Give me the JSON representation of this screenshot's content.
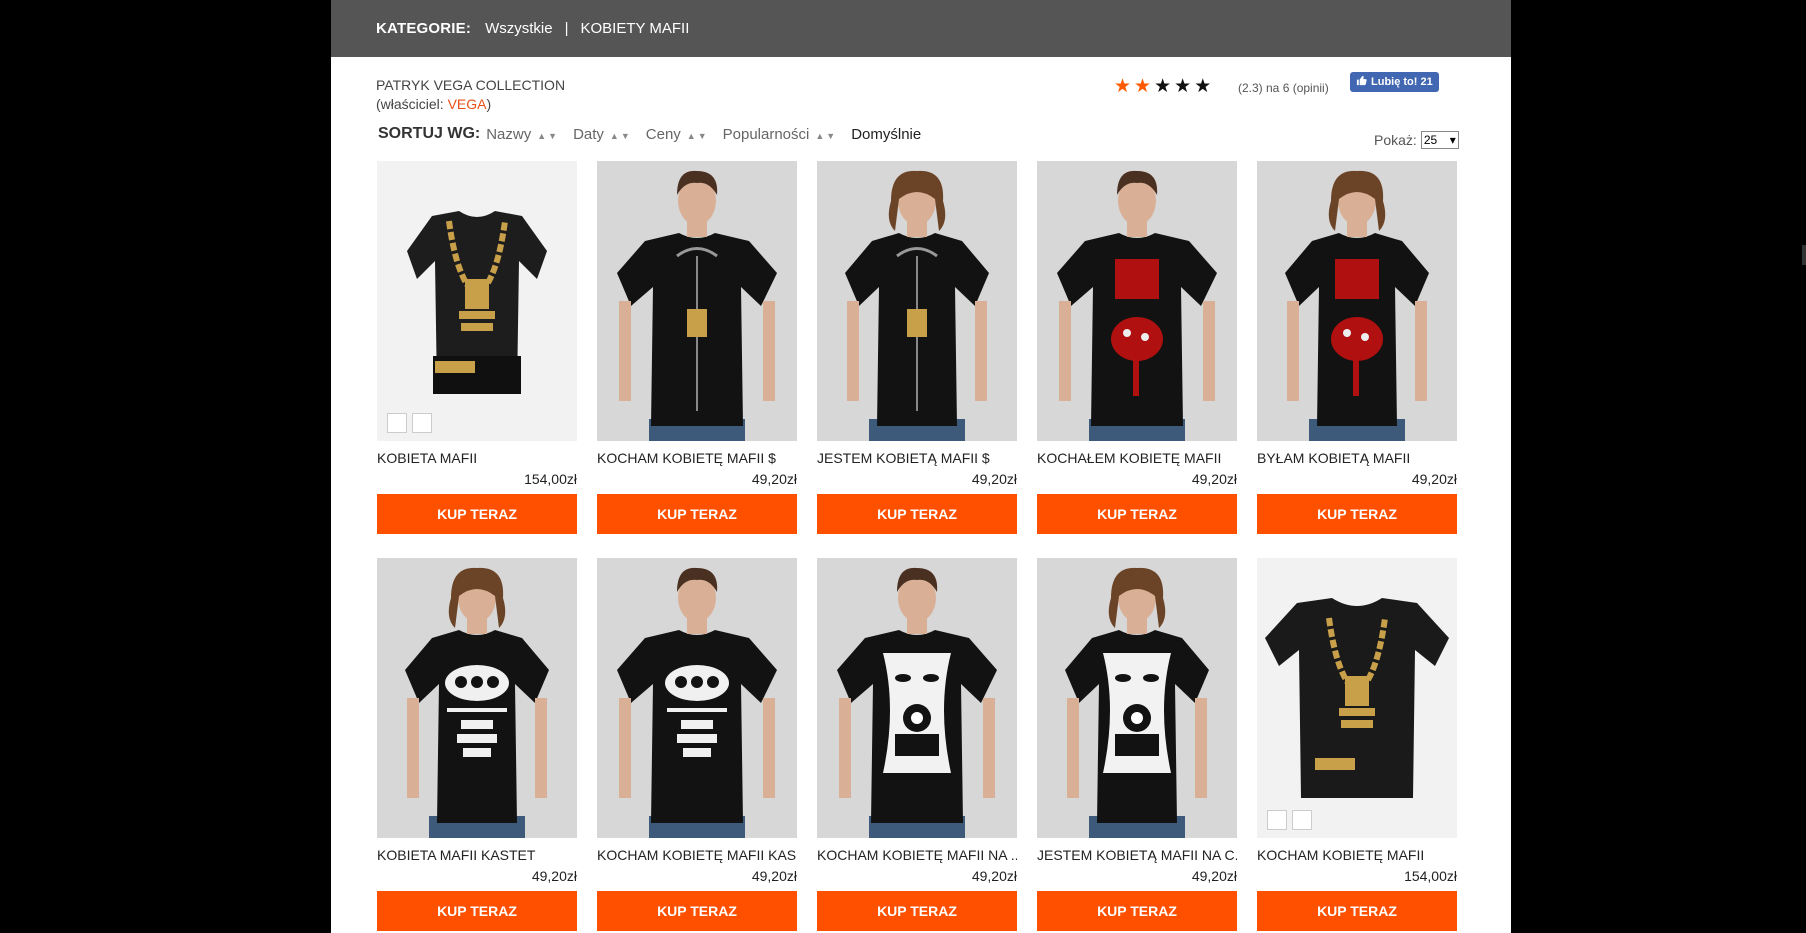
{
  "categories": {
    "label": "KATEGORIE:",
    "items": [
      "Wszystkie",
      "KOBIETY MAFII"
    ],
    "separator": "|"
  },
  "collection": {
    "title": "PATRYK VEGA COLLECTION",
    "owner_prefix": "(właściciel: ",
    "owner_name": "VEGA",
    "owner_suffix": ")"
  },
  "rating": {
    "value": 2,
    "max": 5,
    "text": "(2.3) na 6 (opinii)",
    "star_on_color": "#ff5a00"
  },
  "facebook": {
    "label": "Lubię to! 21",
    "icon": "thumbs-up-icon",
    "color": "#4267b2"
  },
  "sort": {
    "label": "SORTUJ WG:",
    "options": [
      "Nazwy",
      "Daty",
      "Ceny",
      "Popularności"
    ],
    "default": "Domyślnie",
    "arrow_up": "▲",
    "arrow_down": "▼"
  },
  "show": {
    "label": "Pokaż:",
    "value": "25",
    "caret": "▾"
  },
  "buy_label": "KUP TERAZ",
  "accent_color": "#ff5000",
  "products": [
    {
      "name": "KOBIETA MAFII",
      "price": "154,00zł",
      "kind": "allover-woman",
      "print": "chain-gold",
      "swatches": 2
    },
    {
      "name": "KOCHAM KOBIETĘ MAFII $",
      "price": "49,20zł",
      "kind": "man",
      "print": "chain-zip",
      "swatches": 0
    },
    {
      "name": "JESTEM KOBIETĄ MAFII $",
      "price": "49,20zł",
      "kind": "woman",
      "print": "chain-zip",
      "swatches": 0
    },
    {
      "name": "KOCHAŁEM KOBIETĘ MAFII",
      "price": "49,20zł",
      "kind": "man",
      "print": "blood",
      "swatches": 0
    },
    {
      "name": "BYŁAM KOBIETĄ MAFII",
      "price": "49,20zł",
      "kind": "woman",
      "print": "blood",
      "swatches": 0
    },
    {
      "name": "KOBIETA MAFII KASTET",
      "price": "49,20zł",
      "kind": "woman",
      "print": "knuckles",
      "swatches": 0
    },
    {
      "name": "KOCHAM KOBIETĘ MAFII KAS...",
      "price": "49,20zł",
      "kind": "man",
      "print": "knuckles",
      "swatches": 0
    },
    {
      "name": "KOCHAM KOBIETĘ MAFII NA ...",
      "price": "49,20zł",
      "kind": "man",
      "print": "gun-face",
      "swatches": 0
    },
    {
      "name": "JESTEM KOBIETĄ MAFII NA C...",
      "price": "49,20zł",
      "kind": "woman",
      "print": "gun-face",
      "swatches": 0
    },
    {
      "name": "KOCHAM KOBIETĘ MAFII",
      "price": "154,00zł",
      "kind": "allover-man",
      "print": "chain-gold",
      "swatches": 2
    }
  ]
}
